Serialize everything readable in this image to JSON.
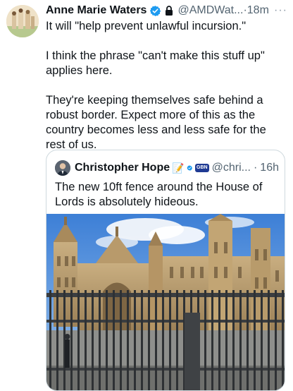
{
  "tweet": {
    "author_name": "Anne Marie Waters",
    "handle": "@AMDWat...",
    "separator": "·",
    "time": "18m",
    "more_label": "···",
    "paragraphs": [
      "It will \"help prevent unlawful incursion.\"",
      "I think the phrase \"can't make this stuff up\" applies here.",
      "They're keeping themselves safe behind a robust border. Expect more of this as the country becomes less and less safe for the rest of us."
    ]
  },
  "quoted_tweet": {
    "author_name": "Christopher Hope",
    "pencil_emoji": "📝",
    "affiliate_badge": "GBN",
    "handle": "@chri...",
    "separator": "·",
    "time": "16h",
    "text": "The new 10ft fence around the House of Lords is absolutely hideous."
  },
  "colors": {
    "text": "#0f1419",
    "secondary": "#536471",
    "verified": "#1d9bf0",
    "border": "#cfd9de"
  },
  "icons": [
    "verified-badge-icon",
    "lock-icon",
    "more-icon",
    "pencil-emoji-icon",
    "affiliate-badge-icon"
  ]
}
